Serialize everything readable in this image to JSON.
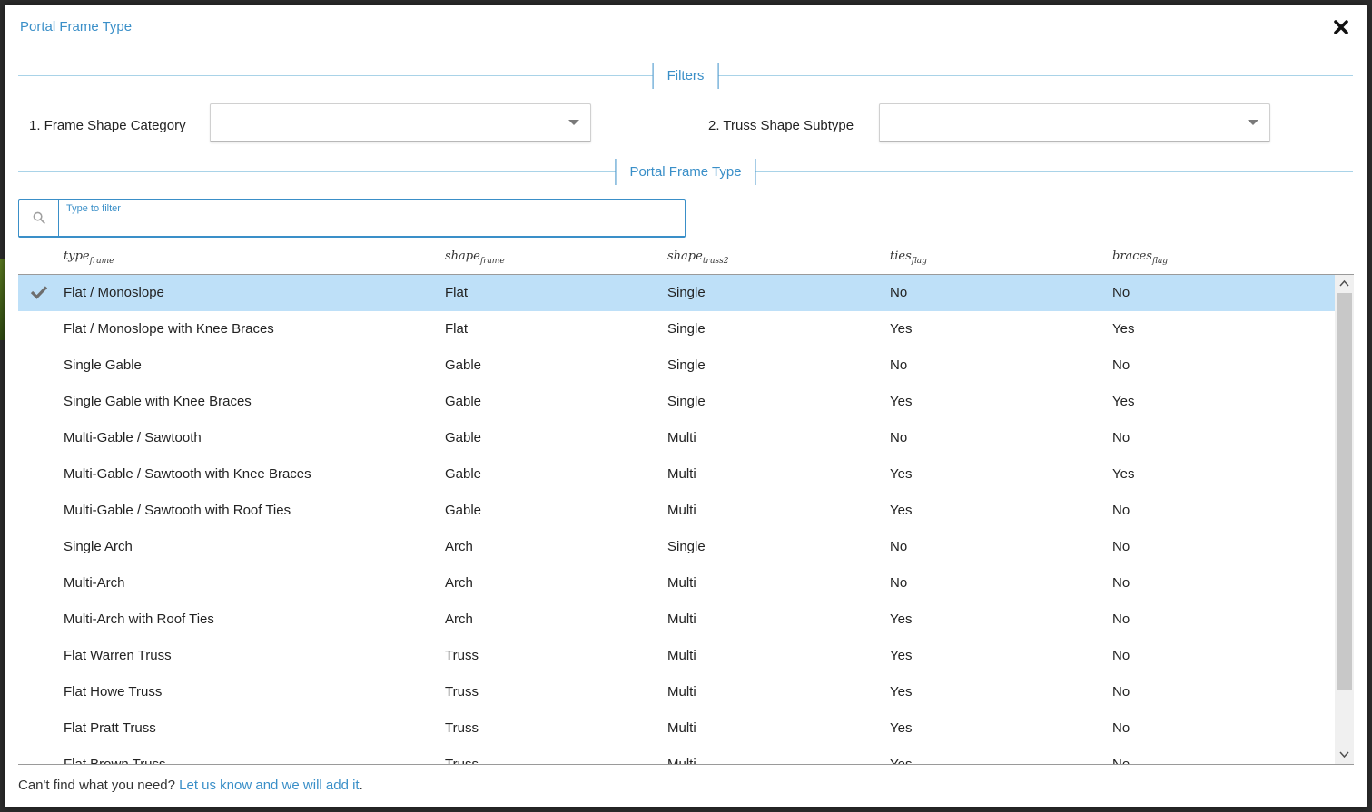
{
  "dialog": {
    "title": "Portal Frame Type"
  },
  "filters_section": {
    "heading": "Filters",
    "frame_shape_category": {
      "label": "1. Frame Shape Category",
      "value": ""
    },
    "truss_shape_subtype": {
      "label": "2. Truss Shape Subtype",
      "value": ""
    }
  },
  "type_section": {
    "heading": "Portal Frame Type"
  },
  "search": {
    "label": "Type to filter",
    "value": "",
    "icon": "search-icon"
  },
  "table": {
    "columns": [
      {
        "main": "type",
        "sub": "frame"
      },
      {
        "main": "shape",
        "sub": "frame"
      },
      {
        "main": "shape",
        "sub": "truss2"
      },
      {
        "main": "ties",
        "sub": "flag"
      },
      {
        "main": "braces",
        "sub": "flag"
      }
    ],
    "selected_index": 0,
    "rows": [
      [
        "Flat / Monoslope",
        "Flat",
        "Single",
        "No",
        "No"
      ],
      [
        "Flat / Monoslope with Knee Braces",
        "Flat",
        "Single",
        "Yes",
        "Yes"
      ],
      [
        "Single Gable",
        "Gable",
        "Single",
        "No",
        "No"
      ],
      [
        "Single Gable with Knee Braces",
        "Gable",
        "Single",
        "Yes",
        "Yes"
      ],
      [
        "Multi-Gable / Sawtooth",
        "Gable",
        "Multi",
        "No",
        "No"
      ],
      [
        "Multi-Gable / Sawtooth with Knee Braces",
        "Gable",
        "Multi",
        "Yes",
        "Yes"
      ],
      [
        "Multi-Gable / Sawtooth with Roof Ties",
        "Gable",
        "Multi",
        "Yes",
        "No"
      ],
      [
        "Single Arch",
        "Arch",
        "Single",
        "No",
        "No"
      ],
      [
        "Multi-Arch",
        "Arch",
        "Multi",
        "No",
        "No"
      ],
      [
        "Multi-Arch with Roof Ties",
        "Arch",
        "Multi",
        "Yes",
        "No"
      ],
      [
        "Flat Warren Truss",
        "Truss",
        "Multi",
        "Yes",
        "No"
      ],
      [
        "Flat Howe Truss",
        "Truss",
        "Multi",
        "Yes",
        "No"
      ],
      [
        "Flat Pratt Truss",
        "Truss",
        "Multi",
        "Yes",
        "No"
      ],
      [
        "Flat Brown Truss",
        "Truss",
        "Multi",
        "Yes",
        "No"
      ]
    ]
  },
  "footer": {
    "prefix": "Can't find what you need? ",
    "link": "Let us know and we will add it",
    "suffix": "."
  },
  "colors": {
    "accent": "#3a8fc8",
    "selected_row": "#bee0f8"
  }
}
